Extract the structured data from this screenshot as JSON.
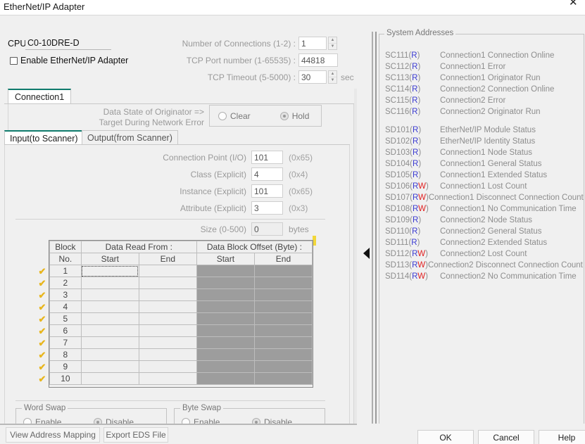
{
  "window": {
    "title": "EtherNet/IP Adapter",
    "close_icon": "close-icon"
  },
  "top_form": {
    "cpu_label": "CPU",
    "cpu_value": "C0-10DRE-D",
    "enable_checkbox_label": "Enable EtherNet/IP Adapter",
    "num_connections_label": "Number of Connections (1-2) :",
    "num_connections_value": "1",
    "tcp_port_label": "TCP Port number (1-65535) :",
    "tcp_port_value": "44818",
    "tcp_timeout_label": "TCP Timeout (5-5000) :",
    "tcp_timeout_value": "30",
    "tcp_timeout_unit": "sec",
    "spin_up": "▲",
    "spin_down": "▼"
  },
  "connection_tabs": [
    {
      "label": "Connection1",
      "active": true
    }
  ],
  "data_state": {
    "label_line1": "Data State of Originator =>",
    "label_line2": "Target During Network Error",
    "options": [
      {
        "label": "Clear",
        "selected": false
      },
      {
        "label": "Hold",
        "selected": true
      }
    ]
  },
  "io_tabs": [
    {
      "label": "Input(to Scanner)",
      "active": true
    },
    {
      "label": "Output(from Scanner)",
      "active": false
    }
  ],
  "params": [
    {
      "label": "Connection Point (I/O)",
      "value": "101",
      "hex": "(0x65)"
    },
    {
      "label": "Class (Explicit)",
      "value": "4",
      "hex": "(0x4)"
    },
    {
      "label": "Instance (Explicit)",
      "value": "101",
      "hex": "(0x65)"
    },
    {
      "label": "Attribute (Explicit)",
      "value": "3",
      "hex": "(0x3)"
    }
  ],
  "size_field": {
    "label": "Size (0-500)",
    "value": "0",
    "unit": "bytes"
  },
  "block_table": {
    "group_headers": [
      "Block",
      "Data Read From :",
      "Data Block Offset (Byte) :"
    ],
    "sub_headers": [
      "No.",
      "Start",
      "End",
      "Start",
      "End"
    ],
    "check_icon": "check-icon",
    "rows": [
      {
        "no": "1",
        "read_start": "",
        "read_end": "",
        "offset_start": "",
        "offset_end": "",
        "checked": true
      },
      {
        "no": "2",
        "read_start": "",
        "read_end": "",
        "offset_start": "",
        "offset_end": "",
        "checked": true
      },
      {
        "no": "3",
        "read_start": "",
        "read_end": "",
        "offset_start": "",
        "offset_end": "",
        "checked": true
      },
      {
        "no": "4",
        "read_start": "",
        "read_end": "",
        "offset_start": "",
        "offset_end": "",
        "checked": true
      },
      {
        "no": "5",
        "read_start": "",
        "read_end": "",
        "offset_start": "",
        "offset_end": "",
        "checked": true
      },
      {
        "no": "6",
        "read_start": "",
        "read_end": "",
        "offset_start": "",
        "offset_end": "",
        "checked": true
      },
      {
        "no": "7",
        "read_start": "",
        "read_end": "",
        "offset_start": "",
        "offset_end": "",
        "checked": true
      },
      {
        "no": "8",
        "read_start": "",
        "read_end": "",
        "offset_start": "",
        "offset_end": "",
        "checked": true
      },
      {
        "no": "9",
        "read_start": "",
        "read_end": "",
        "offset_start": "",
        "offset_end": "",
        "checked": true
      },
      {
        "no": "10",
        "read_start": "",
        "read_end": "",
        "offset_start": "",
        "offset_end": "",
        "checked": true
      }
    ]
  },
  "word_swap": {
    "caption": "Word Swap",
    "options": [
      {
        "label": "Enable",
        "selected": false
      },
      {
        "label": "Disable",
        "selected": true
      }
    ]
  },
  "byte_swap": {
    "caption": "Byte Swap",
    "options": [
      {
        "label": "Enable",
        "selected": false
      },
      {
        "label": "Disable",
        "selected": true
      }
    ]
  },
  "collapse_arrow": {
    "icon": "triangle-left-icon"
  },
  "system_addresses": {
    "caption": "System Addresses",
    "rows": [
      {
        "addr": "SC111",
        "access": "R",
        "desc": "Connection1 Connection Online"
      },
      {
        "addr": "SC112",
        "access": "R",
        "desc": "Connection1 Error"
      },
      {
        "addr": "SC113",
        "access": "R",
        "desc": "Connection1 Originator Run"
      },
      {
        "addr": "SC114",
        "access": "R",
        "desc": "Connection2 Connection Online"
      },
      {
        "addr": "SC115",
        "access": "R",
        "desc": "Connection2 Error"
      },
      {
        "addr": "SC116",
        "access": "R",
        "desc": "Connection2 Originator Run"
      },
      {
        "gap": true
      },
      {
        "addr": "SD101",
        "access": "R",
        "desc": "EtherNet/IP Module Status"
      },
      {
        "addr": "SD102",
        "access": "R",
        "desc": "EtherNet/IP Identity Status"
      },
      {
        "addr": "SD103",
        "access": "R",
        "desc": "Connection1 Node Status"
      },
      {
        "addr": "SD104",
        "access": "R",
        "desc": "Connection1 General Status"
      },
      {
        "addr": "SD105",
        "access": "R",
        "desc": "Connection1 Extended Status"
      },
      {
        "addr": "SD106",
        "access": "RW",
        "desc": "Connection1 Lost Count"
      },
      {
        "addr": "SD107",
        "access": "RW",
        "desc": "Connection1 Disconnect Connection Count"
      },
      {
        "addr": "SD108",
        "access": "RW",
        "desc": "Connection1 No Communication Time"
      },
      {
        "addr": "SD109",
        "access": "R",
        "desc": "Connection2 Node Status"
      },
      {
        "addr": "SD110",
        "access": "R",
        "desc": "Connection2 General Status"
      },
      {
        "addr": "SD111",
        "access": "R",
        "desc": "Connection2 Extended Status"
      },
      {
        "addr": "SD112",
        "access": "RW",
        "desc": "Connection2 Lost Count"
      },
      {
        "addr": "SD113",
        "access": "RW",
        "desc": "Connection2 Disconnect Connection Count"
      },
      {
        "addr": "SD114",
        "access": "RW",
        "desc": "Connection2 No Communication Time"
      }
    ]
  },
  "footer": {
    "view_address_mapping": "View Address Mapping",
    "export_eds_file": "Export EDS File",
    "ok": "OK",
    "cancel": "Cancel",
    "help": "Help"
  },
  "colors": {
    "accent_tab": "#0f7b6c",
    "read_flag": "#3a3ad0",
    "write_flag": "#e02020",
    "check_mark": "#e8b61e",
    "grayed_cell": "#9d9d9d",
    "marker": "#f2d73a"
  }
}
